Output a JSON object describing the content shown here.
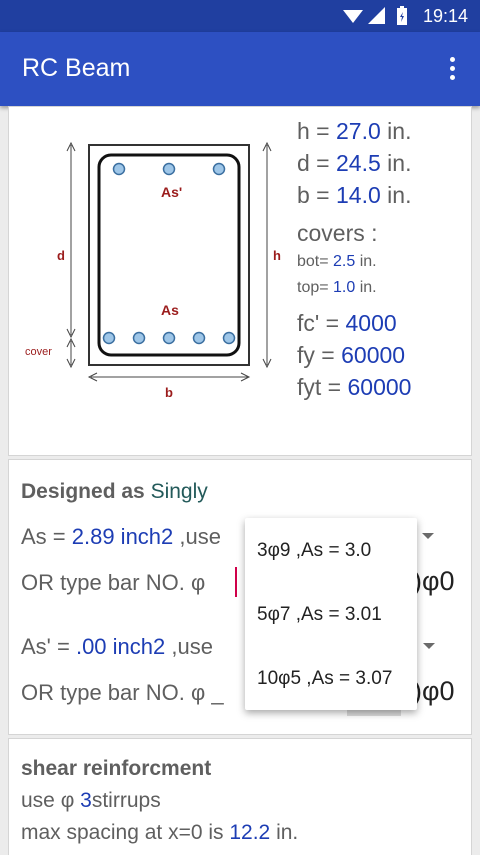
{
  "status": {
    "time": "19:14"
  },
  "app": {
    "title": "RC Beam"
  },
  "diagram": {
    "labels": {
      "as_prime": "As'",
      "as": "As",
      "d": "d",
      "h": "h",
      "b": "b",
      "cover": "cover"
    }
  },
  "dimensions": {
    "h": {
      "label": "h = ",
      "value": "27.0",
      "unit": " in."
    },
    "d": {
      "label": "d = ",
      "value": "24.5",
      "unit": " in."
    },
    "b": {
      "label": "b = ",
      "value": "14.0",
      "unit": " in."
    },
    "covers_label": "covers :",
    "bot": {
      "label": "bot= ",
      "value": "2.5",
      "unit": " in."
    },
    "top": {
      "label": "top= ",
      "value": "1.0",
      "unit": " in."
    },
    "fc": {
      "label": "fc' = ",
      "value": "4000"
    },
    "fy": {
      "label": "fy  = ",
      "value": "60000"
    },
    "fyt": {
      "label": "fyt = ",
      "value": "60000"
    }
  },
  "design": {
    "heading": "Designed as ",
    "mode": "Singly",
    "as_row": {
      "label": "As  = ",
      "value": "2.89 inch2",
      "suffix": " ,use"
    },
    "or_row1": {
      "label": "OR  type bar NO.  φ",
      "trail": ")φ0"
    },
    "as_prime_row": {
      "label": "As' = ",
      "value": ".00 inch2",
      "suffix": " ,use"
    },
    "or_row2": {
      "label": "OR  type bar NO.  φ _",
      "trail": ")φ0"
    }
  },
  "popup": {
    "options": [
      "3φ9 ,As = 3.0",
      "5φ7 ,As = 3.01",
      "10φ5 ,As = 3.07"
    ]
  },
  "shear": {
    "heading": "shear reinforcment",
    "use_label": "use   φ ",
    "use_value": "3",
    "use_suffix": "stirrups",
    "spacing_label": "max spacing at x=0  is  ",
    "spacing_value": "12.2",
    "spacing_unit": " in."
  }
}
